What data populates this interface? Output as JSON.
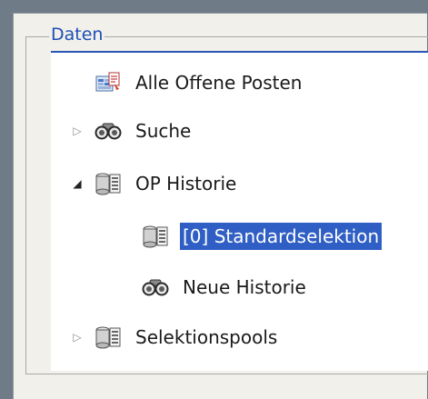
{
  "groupbox": {
    "title": "Daten"
  },
  "tree": {
    "items": [
      {
        "label": "Alle Offene Posten",
        "icon": "report-icon",
        "expander": "none",
        "selected": false
      },
      {
        "label": "Suche",
        "icon": "binoculars-icon",
        "expander": "collapsed",
        "selected": false
      },
      {
        "label": "OP Historie",
        "icon": "database-icon",
        "expander": "expanded",
        "selected": false
      },
      {
        "label": "[0] Standardselektion",
        "icon": "database-icon",
        "expander": "none",
        "selected": true
      },
      {
        "label": "Neue Historie",
        "icon": "binoculars-icon",
        "expander": "none",
        "selected": false
      },
      {
        "label": "Selektionspools",
        "icon": "database-icon",
        "expander": "collapsed",
        "selected": false
      }
    ]
  },
  "colors": {
    "frame": "#6f7b86",
    "window": "#f2f0ea",
    "legend_text": "#1e4fb8",
    "selection": "#2f5fc4"
  }
}
